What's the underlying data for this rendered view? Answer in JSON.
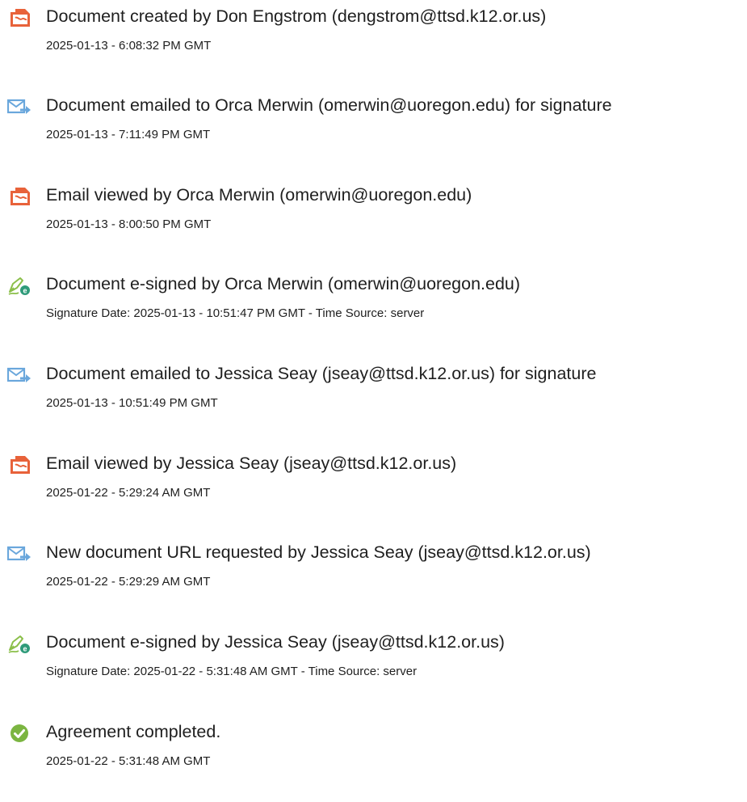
{
  "events": [
    {
      "icon": "document-icon",
      "title": "Document created by Don Engstrom (dengstrom@ttsd.k12.or.us)",
      "time": "2025-01-13 - 6:08:32 PM GMT"
    },
    {
      "icon": "email-sent-icon",
      "title": "Document emailed to Orca Merwin (omerwin@uoregon.edu) for signature",
      "time": "2025-01-13 - 7:11:49 PM GMT"
    },
    {
      "icon": "document-icon",
      "title": "Email viewed by Orca Merwin (omerwin@uoregon.edu)",
      "time": "2025-01-13 - 8:00:50 PM GMT"
    },
    {
      "icon": "e-sign-pen-icon",
      "title": "Document e-signed by Orca Merwin (omerwin@uoregon.edu)",
      "time": "Signature Date: 2025-01-13 - 10:51:47 PM GMT - Time Source: server"
    },
    {
      "icon": "email-sent-icon",
      "title": "Document emailed to Jessica Seay (jseay@ttsd.k12.or.us) for signature",
      "time": "2025-01-13 - 10:51:49 PM GMT"
    },
    {
      "icon": "document-icon",
      "title": "Email viewed by Jessica Seay (jseay@ttsd.k12.or.us)",
      "time": "2025-01-22 - 5:29:24 AM GMT"
    },
    {
      "icon": "email-sent-icon",
      "title": "New document URL requested by Jessica Seay (jseay@ttsd.k12.or.us)",
      "time": "2025-01-22 - 5:29:29 AM GMT"
    },
    {
      "icon": "e-sign-pen-icon",
      "title": "Document e-signed by Jessica Seay (jseay@ttsd.k12.or.us)",
      "time": "Signature Date: 2025-01-22 - 5:31:48 AM GMT - Time Source: server"
    },
    {
      "icon": "check-circle-icon",
      "title": "Agreement completed.",
      "time": "2025-01-22 - 5:31:48 AM GMT"
    }
  ],
  "colors": {
    "document_icon": "#e8623a",
    "email_icon": "#6aa7dc",
    "pen_icon": "#8bbf4a",
    "check_icon": "#7bb541",
    "text": "#1f1f1f"
  }
}
